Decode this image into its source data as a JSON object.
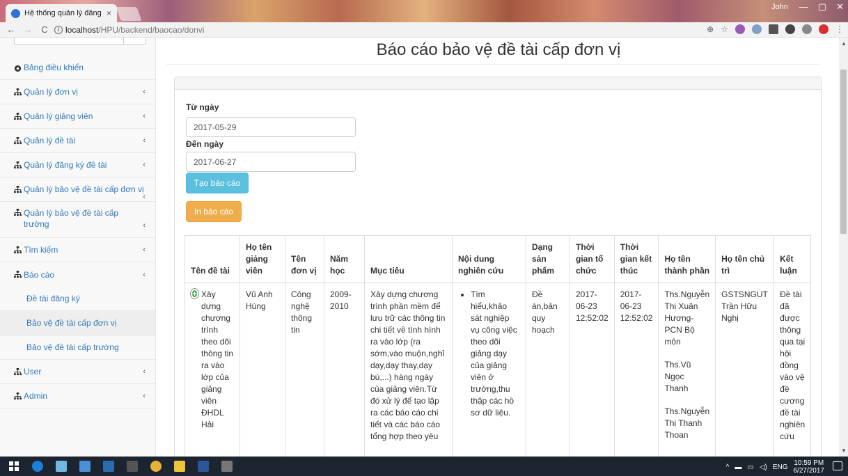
{
  "browser": {
    "tab_title": "Hệ thống quản lý đăng k",
    "tab_close": "×",
    "window_user": "John",
    "url_host": "localhost",
    "url_path": "/HPU/backend/baocao/donvi"
  },
  "sidebar": {
    "items": [
      {
        "label": "Bảng điều khiển",
        "icon": "dashboard-icon"
      },
      {
        "label": "Quản lý đơn vị",
        "icon": "sitemap-icon"
      },
      {
        "label": "Quản lý giảng viên",
        "icon": "sitemap-icon"
      },
      {
        "label": "Quản lý đề tài",
        "icon": "sitemap-icon"
      },
      {
        "label": "Quản lý đăng ký đề tài",
        "icon": "sitemap-icon"
      },
      {
        "label": "Quản lý bảo vệ đề tài cấp đơn vị",
        "icon": "sitemap-icon"
      },
      {
        "label": "Quản lý bảo vệ đề tài cấp trường",
        "icon": "sitemap-icon"
      },
      {
        "label": "Tìm kiếm",
        "icon": "sitemap-icon"
      },
      {
        "label": "Báo cáo",
        "icon": "sitemap-icon"
      },
      {
        "label": "User",
        "icon": "sitemap-icon"
      },
      {
        "label": "Admin",
        "icon": "sitemap-icon"
      }
    ],
    "report_sub": [
      {
        "label": "Đề tài đăng ký"
      },
      {
        "label": "Bảo vệ đề tài cấp đơn vị",
        "active": true
      },
      {
        "label": "Bảo vệ đề tài cấp trường"
      }
    ]
  },
  "main": {
    "title": "Báo cáo bảo vệ đề tài cấp đơn vị",
    "from_label": "Từ ngày",
    "from_value": "2017-05-29",
    "to_label": "Đến ngày",
    "to_value": "2017-06-27",
    "create_button": "Tạo báo cáo",
    "print_button": "In báo cáo"
  },
  "table": {
    "headers": [
      "Tên đề tài",
      "Họ tên giảng viên",
      "Tên đơn vị",
      "Năm học",
      "Mục tiêu",
      "Nội dung nghiên cứu",
      "Dạng sản phẩm",
      "Thời gian tổ chức",
      "Thời gian kết thúc",
      "Họ tên thành phần",
      "Họ tên chủ trì",
      "Kết luận"
    ],
    "row": {
      "ten_de_tai": "Xây dựng chương trình theo dõi thông tin ra vào lớp của giảng viên ĐHDL Hải",
      "giang_vien": "Vũ Anh Hùng",
      "don_vi": "Công nghệ thông tin",
      "nam_hoc": "2009-2010",
      "muc_tieu": "Xây dựng chương trình phần mềm để lưu trữ các thông tin chi tiết về tình hình ra vào lớp (ra sớm,vào muộn,nghỉ dạy,dạy thay,dạy bù,...) hàng ngày của giảng viên.Từ đó xử lý để tạo lập ra các báo cáo chi tiết và các báo cáo tổng hợp theo yêu",
      "noi_dung": "Tìm hiểu,khảo sát nghiệp vụ công việc theo dõi giảng dạy của giảng viên ở trường,thu thập các hồ sơ dữ liệu.",
      "dang_san_pham": "Đề án,bản quy hoạch",
      "tg_to_chuc": "2017-06-23 12:52:02",
      "tg_ket_thuc": "2017-06-23 12:52:02",
      "thanh_phan": [
        "Ths.Nguyễn Thị Xuân Hương-PCN Bộ môn",
        "Ths.Vũ Ngọc Thanh",
        "Ths.Nguyễn Thị Thanh Thoan"
      ],
      "chu_tri": "GSTSNGUT Trần Hữu Nghị",
      "ket_luan": "Đề tài đã được thông qua tại hội đồng vào vệ đề cương đề tài nghiên cứu"
    }
  },
  "taskbar": {
    "lang": "ENG",
    "time": "10:59 PM",
    "date": "6/27/2017"
  },
  "colors": {
    "info": "#5bc0de",
    "warning": "#f0ad4e",
    "link": "#337ab7"
  }
}
